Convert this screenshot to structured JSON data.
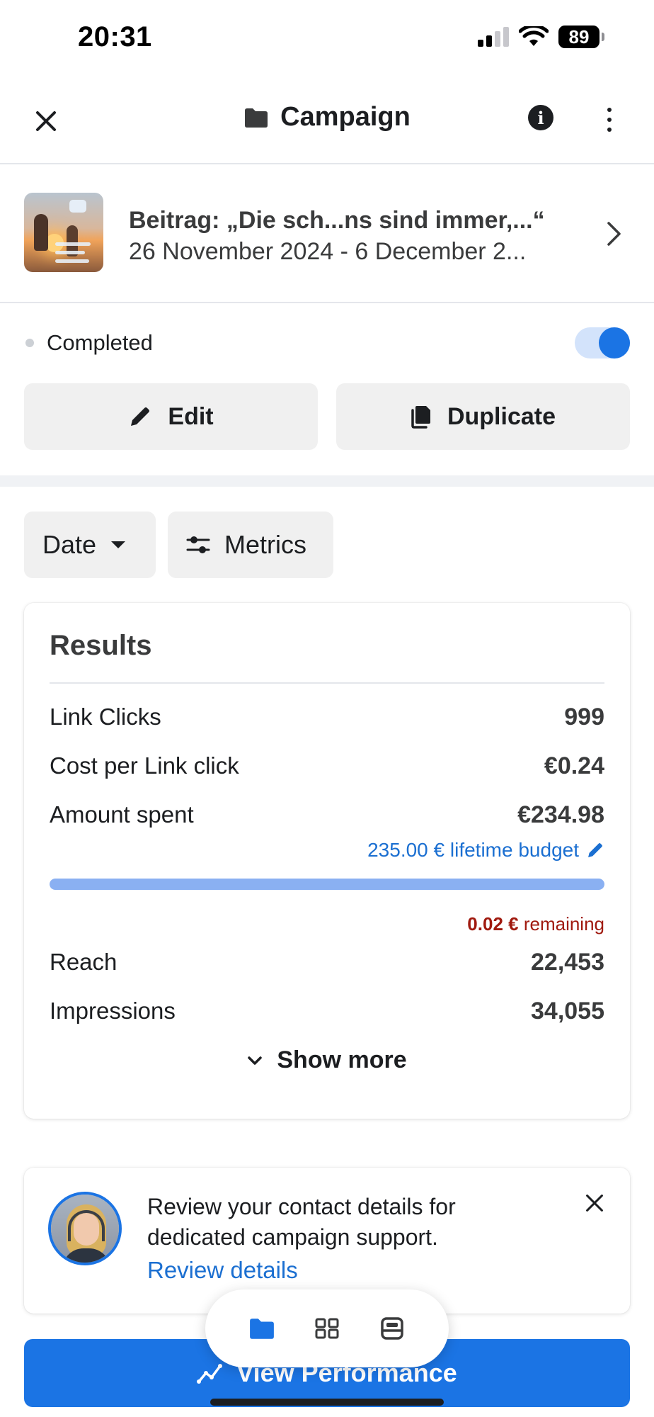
{
  "status_bar": {
    "time": "20:31",
    "battery": "89"
  },
  "header": {
    "title": "Campaign",
    "title_icon": "folder-icon",
    "close_icon": "close-icon",
    "info_icon": "info-icon",
    "more_icon": "more-vertical-icon"
  },
  "ad": {
    "title": "Beitrag: „Die sch...ns sind immer,...“",
    "dates": "26 November 2024 - 6 December 2...",
    "chevron_icon": "chevron-right-icon"
  },
  "status": {
    "label": "Completed",
    "toggle_on": true,
    "accent": "#1b74e4"
  },
  "actions": {
    "edit_label": "Edit",
    "edit_icon": "pencil-icon",
    "duplicate_label": "Duplicate",
    "duplicate_icon": "copy-icon"
  },
  "filters": {
    "date_label": "Date",
    "date_icon": "caret-down-icon",
    "metrics_label": "Metrics",
    "metrics_icon": "sliders-icon"
  },
  "results": {
    "title": "Results",
    "rows": [
      {
        "label": "Link Clicks",
        "value": "999"
      },
      {
        "label": "Cost per Link click",
        "value": "€0.24"
      },
      {
        "label": "Amount spent",
        "value": "€234.98"
      }
    ],
    "budget_text": "235.00 € lifetime budget",
    "budget_progress": 0.9999,
    "remaining_amount": "0.02 €",
    "remaining_label": "remaining",
    "rows_more": [
      {
        "label": "Reach",
        "value": "22,453"
      },
      {
        "label": "Impressions",
        "value": "34,055"
      }
    ],
    "show_more_label": "Show more"
  },
  "support": {
    "message": "Review your contact details for dedicated campaign support.",
    "link": "Review details"
  },
  "performance_button": {
    "label": "View Performance",
    "icon": "trend-line-icon"
  },
  "nav": {
    "items": [
      "folder-icon",
      "grid-icon",
      "inbox-icon"
    ]
  }
}
